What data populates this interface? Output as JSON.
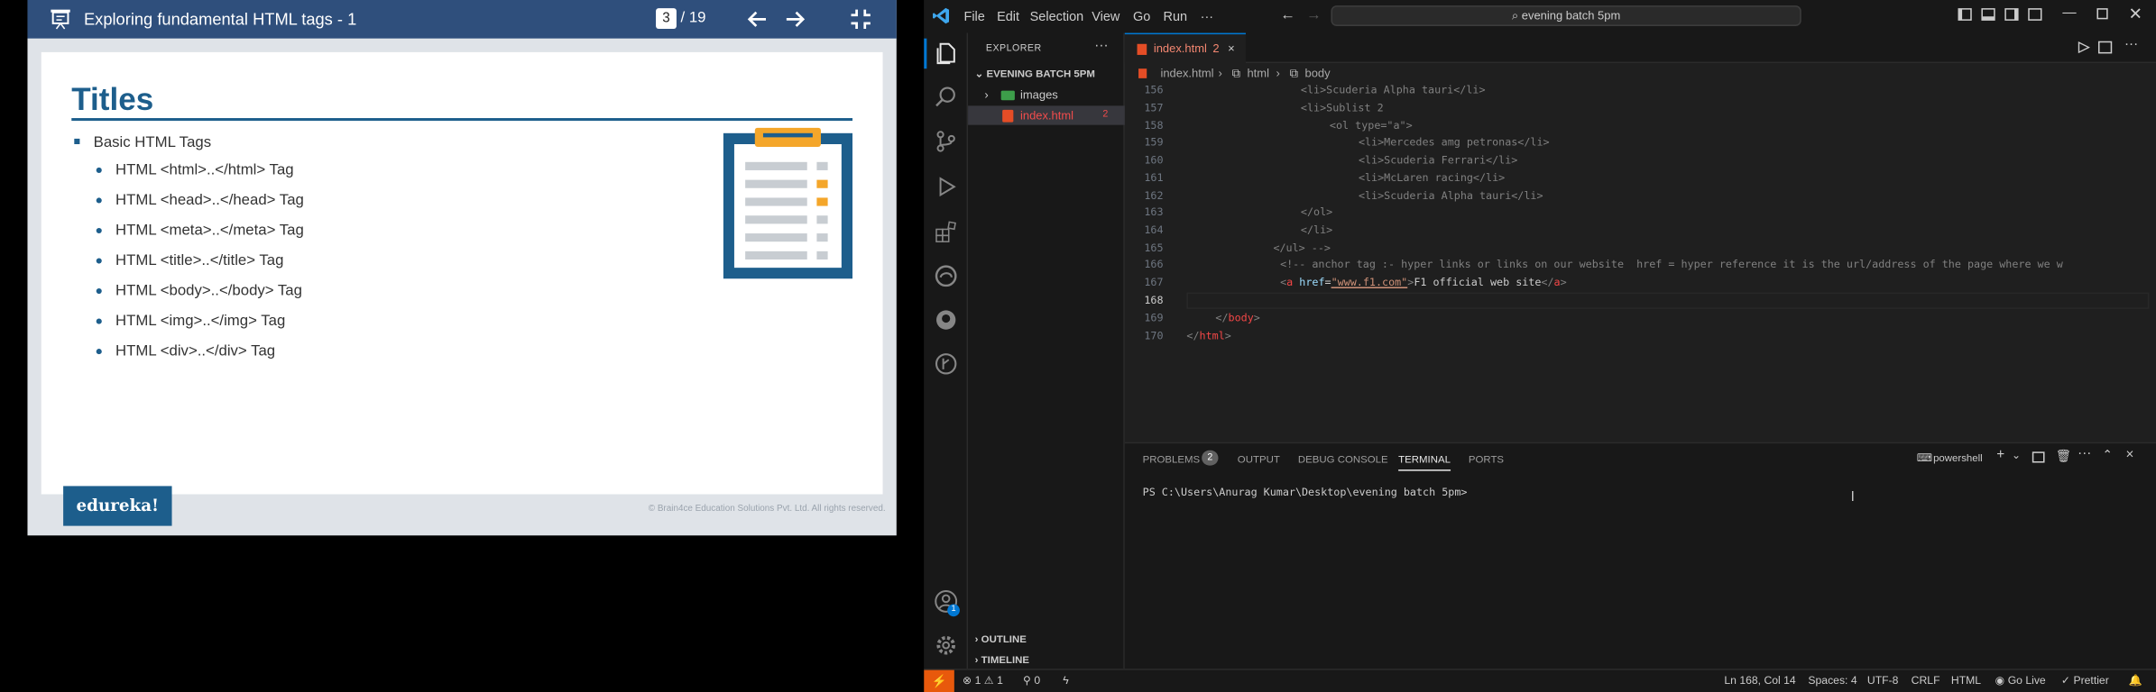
{
  "viewer": {
    "title": "Exploring fundamental HTML tags - 1",
    "page_current": "3",
    "page_total": "/ 19",
    "slide": {
      "title": "Titles",
      "bullet": "Basic HTML Tags",
      "subbullets": [
        "HTML <html>..</html> Tag",
        "HTML <head>..</head> Tag",
        "HTML <meta>..</meta> Tag",
        "HTML <title>..</title> Tag",
        "HTML <body>..</body> Tag",
        "HTML <img>..</img> Tag",
        "HTML <div>..</div> Tag"
      ]
    },
    "logo": "edureka!",
    "copyright": "© Brain4ce Education Solutions Pvt. Ltd. All rights reserved."
  },
  "vscode": {
    "menu": [
      "File",
      "Edit",
      "Selection",
      "View",
      "Go",
      "Run",
      "···"
    ],
    "search": "evening batch 5pm",
    "explorer_title": "EXPLORER",
    "folder": "EVENING BATCH 5PM",
    "tree": [
      {
        "label": "images",
        "type": "folder"
      },
      {
        "label": "index.html",
        "type": "file",
        "count": "2"
      }
    ],
    "outline": "OUTLINE",
    "timeline": "TIMELINE",
    "tab": {
      "label": "index.html",
      "count": "2"
    },
    "breadcrumb": [
      "index.html",
      "html",
      "body"
    ],
    "line_numbers": [
      "156",
      "157",
      "158",
      "159",
      "160",
      "161",
      "162",
      "163",
      "164",
      "165",
      "166",
      "167",
      "168",
      "169",
      "170"
    ],
    "code_lines": [
      "<li>Scuderia Alpha tauri</li>",
      "<li>Sublist 2",
      "<ol type=\"a\">",
      "<li>Mercedes amg petronas</li>",
      "<li>Scuderia Ferrari</li>",
      "<li>McLaren racing</li>",
      "<li>Scuderia Alpha tauri</li>",
      "</ol>",
      "</li>",
      "</ul> -->",
      "<!-- anchor tag :- hyper links or links on our website  href = hyper reference it is the url/address of the page where we w",
      "<a href=\"www.f1.com\">F1 official web site</a>",
      "",
      "</body>",
      "</html>"
    ],
    "panel_tabs": [
      "PROBLEMS",
      "OUTPUT",
      "DEBUG CONSOLE",
      "TERMINAL",
      "PORTS"
    ],
    "problems_count": "2",
    "terminal_shell": "powershell",
    "terminal_prompt": "PS C:\\Users\\Anurag Kumar\\Desktop\\evening batch 5pm>",
    "status": {
      "errors": "1",
      "warnings": "1",
      "ports": "0",
      "position": "Ln 168, Col 14",
      "spaces": "Spaces: 4",
      "encoding": "UTF-8",
      "eol": "CRLF",
      "language": "HTML",
      "golive": "Go Live",
      "prettier": "Prettier"
    },
    "accounts_badge": "1"
  }
}
